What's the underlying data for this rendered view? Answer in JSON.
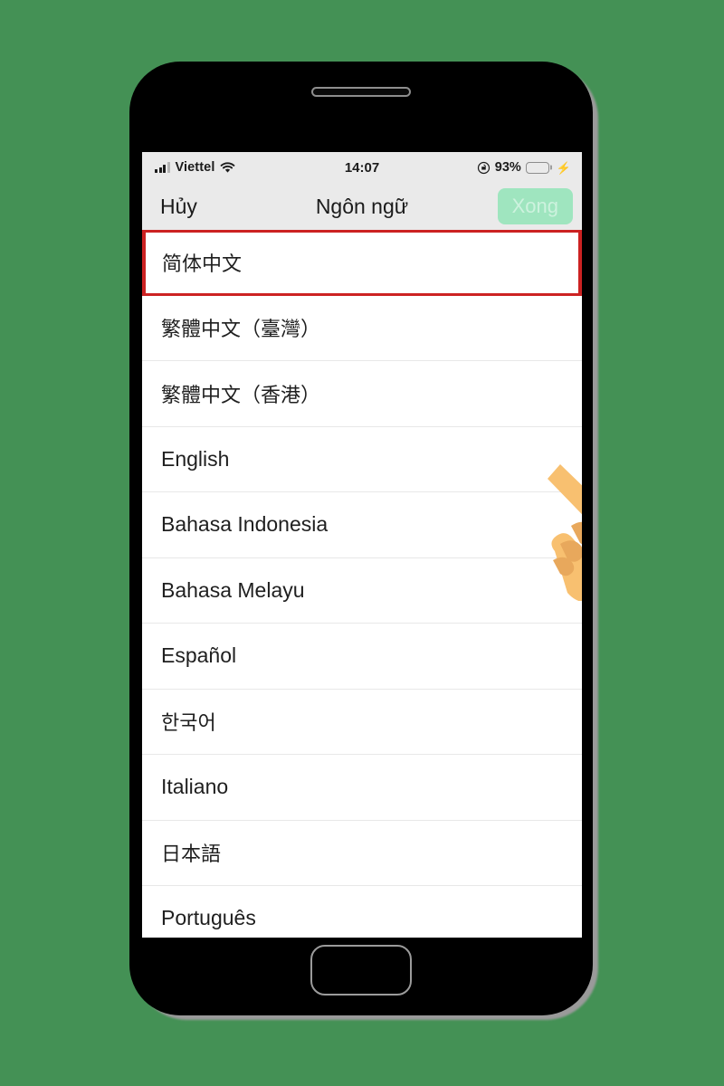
{
  "background_color": "#449155",
  "device": {
    "frame_color": "#000000",
    "earpiece": "earpiece-speaker",
    "home_button": "home-button"
  },
  "status_bar": {
    "carrier": "Viettel",
    "signal_icon": "signal-bars-icon",
    "wifi_icon": "wifi-icon",
    "time": "14:07",
    "rotation_lock_icon": "rotation-lock-icon",
    "battery_percent": "93%",
    "battery_level": 93,
    "battery_color": "#31d158",
    "charging_icon": "charging-bolt-icon",
    "background_color": "#eaeaea"
  },
  "nav_bar": {
    "cancel_label": "Hủy",
    "title": "Ngôn ngữ",
    "done_label": "Xong",
    "done_enabled": false,
    "done_background": "#9fe5bf",
    "done_text_color": "#cdf2de"
  },
  "highlight": {
    "color": "#cc2222",
    "target_index": 0
  },
  "hand_cursor": {
    "name": "pointing-hand-cursor",
    "skin_color": "#f8c070",
    "skin_shadow": "#e8a85c",
    "cuff_color": "#119172",
    "cuff_dot_color": "#cfe4dd"
  },
  "language_list": {
    "items": [
      {
        "label": "简体中文",
        "script": "cjk",
        "highlighted": true
      },
      {
        "label": "繁體中文（臺灣）",
        "script": "cjk",
        "highlighted": false
      },
      {
        "label": "繁體中文（香港）",
        "script": "cjk",
        "highlighted": false
      },
      {
        "label": "English",
        "script": "latin",
        "highlighted": false
      },
      {
        "label": "Bahasa Indonesia",
        "script": "latin",
        "highlighted": false
      },
      {
        "label": "Bahasa Melayu",
        "script": "latin",
        "highlighted": false
      },
      {
        "label": "Español",
        "script": "latin",
        "highlighted": false
      },
      {
        "label": "한국어",
        "script": "cjk",
        "highlighted": false
      },
      {
        "label": "Italiano",
        "script": "latin",
        "highlighted": false
      },
      {
        "label": "日本語",
        "script": "cjk",
        "highlighted": false
      },
      {
        "label": "Português",
        "script": "latin",
        "highlighted": false
      }
    ]
  }
}
